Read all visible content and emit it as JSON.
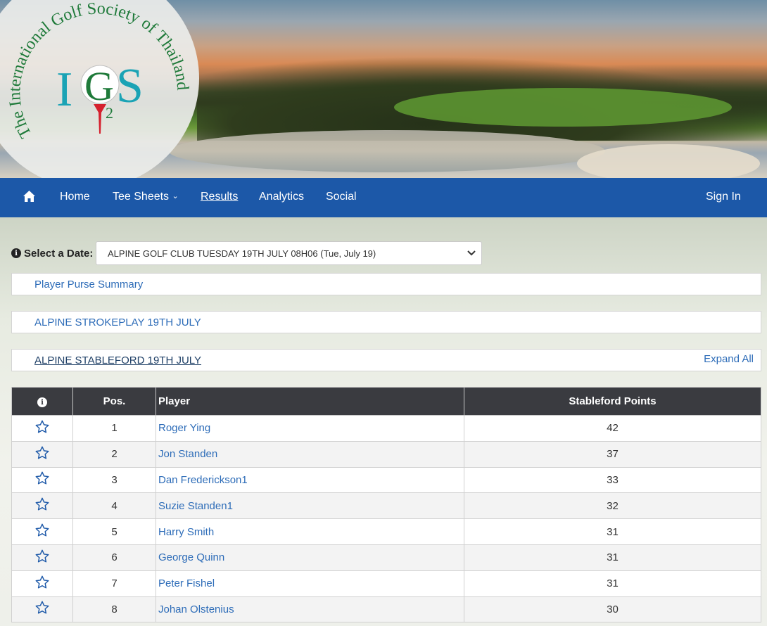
{
  "logo": {
    "ring_text": "The International Golf Society of Thailand",
    "letters": "IGS",
    "superscript": "2"
  },
  "nav": {
    "home_icon": "home-icon",
    "items": [
      {
        "label": "Home"
      },
      {
        "label": "Tee Sheets",
        "has_dropdown": true
      },
      {
        "label": "Results",
        "active": true
      },
      {
        "label": "Analytics"
      },
      {
        "label": "Social"
      }
    ],
    "sign_in": "Sign In"
  },
  "date_select": {
    "label": "Select a Date:",
    "value": "ALPINE GOLF CLUB TUESDAY 19TH JULY 08H06 (Tue, July 19)"
  },
  "panels": [
    {
      "title": "Player Purse Summary"
    },
    {
      "title": "ALPINE STROKEPLAY 19TH JULY"
    },
    {
      "title": "ALPINE STABLEFORD 19TH JULY",
      "expand_label": "Expand All"
    }
  ],
  "table": {
    "headers": {
      "info": "i",
      "pos": "Pos.",
      "player": "Player",
      "points": "Stableford Points"
    },
    "rows": [
      {
        "pos": "1",
        "player": "Roger Ying",
        "points": "42"
      },
      {
        "pos": "2",
        "player": "Jon Standen",
        "points": "37"
      },
      {
        "pos": "3",
        "player": "Dan Frederickson1",
        "points": "33"
      },
      {
        "pos": "4",
        "player": "Suzie Standen1",
        "points": "32"
      },
      {
        "pos": "5",
        "player": "Harry Smith",
        "points": "31"
      },
      {
        "pos": "6",
        "player": "George Quinn",
        "points": "31"
      },
      {
        "pos": "7",
        "player": "Peter Fishel",
        "points": "31"
      },
      {
        "pos": "8",
        "player": "Johan Olstenius",
        "points": "30"
      }
    ]
  },
  "colors": {
    "nav_bg": "#1c58a8",
    "link": "#2d6cb8",
    "table_header": "#3a3b40",
    "logo_green": "#1f7a3a",
    "logo_teal": "#1aa3b5",
    "logo_red": "#d5212e"
  }
}
